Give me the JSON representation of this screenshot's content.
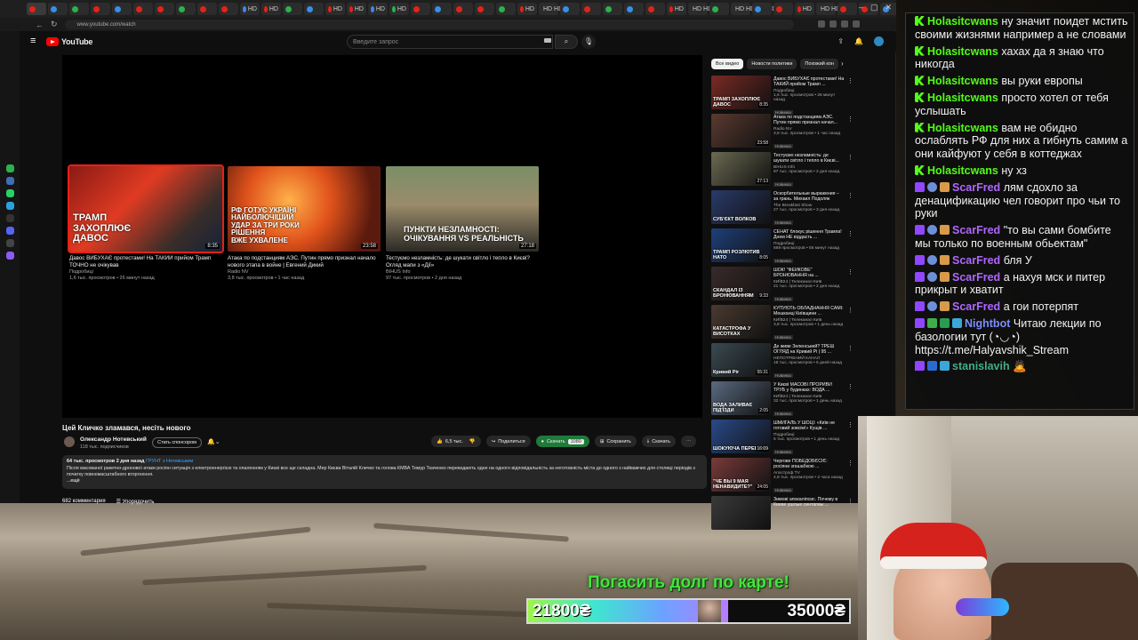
{
  "browser": {
    "url": "www.youtube.com/watch",
    "tabs": [
      "",
      "",
      "",
      "",
      "",
      "",
      "",
      "",
      "",
      "",
      "HD",
      "HD",
      "",
      "",
      "HD",
      "HD",
      "HD",
      "HD",
      "",
      "",
      "",
      "",
      "",
      "HD",
      "HD HD HD",
      "",
      "",
      "",
      "",
      "",
      "HD",
      "HD HD HD",
      "",
      "HD HD HD HD",
      "",
      "",
      "HD",
      "HD HD HD",
      "",
      "",
      "",
      "",
      "",
      "HD",
      "HD"
    ]
  },
  "youtube": {
    "search_placeholder": "Введите запрос",
    "endcards": [
      {
        "title": "Давос ВИБУХАЄ протестами! На ТАКИЙ прийом Трамп ТОЧНО не очікував",
        "channel": "Подробиці",
        "meta": "1,6 тыс. просмотров • 26 минут назад",
        "duration": "8:35",
        "overlay": "ТРАМП\nЗАХОПЛЮЄ\nДАВОС"
      },
      {
        "title": "Атака по подстанциям АЭС. Путин прямо признал начало нового этапа в войне | Евгений Дикий",
        "channel": "Radio NV",
        "meta": "3,8 тыс. просмотров • 1 час назад",
        "duration": "23:58",
        "overlay": "РФ ГОТУЄ УКРАЇНІ\nНАЙБОЛЮЧІШИЙ\nУДАР ЗА ТРИ РОКИ\nРІШЕННЯ\nВЖЕ УХВАЛЕНЕ"
      },
      {
        "title": "Тестуємо незламність: де шукати світло і тепло в Києві? Огляд мапи з «Дії»",
        "channel": "BIHUS Info",
        "meta": "97 тыс. просмотров • 2 дня назад",
        "duration": "27:18",
        "overlay": "ПУНКТИ НЕЗЛАМНОСТІ:\nОЧІКУВАННЯ VS РЕАЛЬНІСТЬ"
      }
    ],
    "video": {
      "title": "Цей Кличко зламався, несіть нового",
      "channel": "Олександр Нотевський",
      "subscribers": "118 тыс. подписчиков",
      "sponsor_label": "Стать спонсором",
      "likes": "6,5 тыс.",
      "share_label": "Поделиться",
      "download_btn_label": "Скачать",
      "save_label": "Сохранить",
      "download_label": "Скачать",
      "desc_meta": "64 тыс. просмотров  2 дня назад",
      "desc_tags": "ГРУНТ з Нотевським",
      "description": "Після масованої ракетно-дронової атаки росіян ситуація з електроенергією та опаленням у Києві все ще складна. Мер Києва Віталій Кличко та голова КМВА Тимур Ткаченко перекидають одне на одного відповідальність за неготовність міста до одного з найважчих для столиці періодів з початку повномасштабного вторгнення.",
      "desc_more": "...ещё",
      "comments_count": "682 комментария",
      "sort_label": "Упорядочить"
    },
    "chips": [
      "Все видео",
      "Новости политики",
      "Похожий кон"
    ],
    "related": [
      {
        "title": "Давос ВИБУХАЄ протестами! На ТАКИЙ прийом Трамп ...",
        "channel": "Подробиці",
        "meta": "1,6 тыс. просмотров • 26 минут назад",
        "badge": "Новинка",
        "duration": "8:35",
        "overlay": "ТРАМП ЗАХОПЛЮЄ ДАВОС"
      },
      {
        "title": "Атака по подстанциям АЭС. Путин прямо признал начал...",
        "channel": "Radio NV",
        "meta": "3,8 тыс. просмотров • 1 час назад",
        "badge": "Новинка",
        "duration": "23:58",
        "overlay": ""
      },
      {
        "title": "Тестуємо незламність: де шукати світло і тепло в Києві...",
        "channel": "BIHUS Info",
        "meta": "97 тыс. просмотров • 2 дня назад",
        "badge": "Новинка",
        "duration": "27:13",
        "overlay": ""
      },
      {
        "title": "Оскорбительные выражения – за грань. Михаил Подоляк",
        "channel": "The Breakfast Show",
        "meta": "27 тыс. просмотров • 3 дня назад",
        "badge": "Новинка",
        "duration": "",
        "overlay": "СУБ'ЄКТ ВОЛКОВ"
      },
      {
        "title": "СЕНАТ блокує рішення Трампа! Днем НЕ віддасть ...",
        "channel": "Подробиці",
        "meta": "669 просмотров • 56 минут назад",
        "badge": "Новинка",
        "duration": "8:05",
        "overlay": "ТРАМП РОЗЛЮТИВ НАТО"
      },
      {
        "title": "ШОК! \"ФЕЙКОВЕ\" БРОНЮВАННЯ на ...",
        "channel": "КИЇВ24 | Телеканал Київ",
        "meta": "21 тыс. просмотров • 2 дня назад",
        "badge": "Новинка",
        "duration": "9:33",
        "overlay": "СКАНДАЛ ІЗ БРОНЮВАННЯМ"
      },
      {
        "title": "КУПУЮТЬ ОБЛАДНАННЯ САМІ: Мешканці Київщини ...",
        "channel": "КИЇВ24 | Телеканал Київ",
        "meta": "3,8 тыс. просмотров • 1 день назад",
        "badge": "Новинка",
        "duration": "",
        "overlay": "КАТАСТРОФА У ВИСОТКАХ"
      },
      {
        "title": "Де живе Зеленський? ТРЕШ ОГЛЯД на Кривий Рі | 95 ...",
        "channel": "НЕПОТРІБНИЙ КАНАЛ",
        "meta": "18 тыс. просмотров • 5 дней назад",
        "badge": "Новинка",
        "duration": "55:31",
        "overlay": "Кривий Ріг"
      },
      {
        "title": "У Києві МАСОВІ ПРОРИВИ ТРУБ у будинках: ВОДА ...",
        "channel": "КИЇВ24 | Телеканал Київ",
        "meta": "32 тыс. просмотров • 1 день назад",
        "badge": "Новинка",
        "duration": "2:05",
        "overlay": "ВОДА ЗАЛИВАЄ ПІД'ЇЗДИ"
      },
      {
        "title": "ШМИГАЛЬ У ШОЦІ: «Київ не готовий зовсім!» Кущів ...",
        "channel": "Подробиці",
        "meta": "5 тыс. просмотров • 1 день назад",
        "badge": "Новинка",
        "duration": "16:09",
        "overlay": "ШОКУЮЧА ПЕРЕВІРКА"
      },
      {
        "title": "Черговe ПОБЕДОБЄСІЄ: росіяни згашабкою ...",
        "channel": "Апостроф TV",
        "meta": "4,8 тыс. просмотров • 2 часа назад",
        "badge": "Новинка",
        "duration": "24:05",
        "overlay": "\"ЧЕ ВЫ 9 МАЯ НЕНАВИДИТЕ?\""
      },
      {
        "title": "Зимові апокаліпсис. Почему в Киеве ушлые синтагмы ...",
        "channel": "",
        "meta": "",
        "badge": "",
        "duration": "",
        "overlay": ""
      }
    ]
  },
  "chat": [
    {
      "badges": [
        "kick"
      ],
      "nick": "Holasitcwans",
      "nick_color": "#53fc18",
      "text": "ну значит поидет мстить своими жизнями например а не словами"
    },
    {
      "badges": [
        "kick"
      ],
      "nick": "Holasitcwans",
      "nick_color": "#53fc18",
      "text": "хахах да я знаю что никогда"
    },
    {
      "badges": [
        "kick"
      ],
      "nick": "Holasitcwans",
      "nick_color": "#53fc18",
      "text": "вы руки европы"
    },
    {
      "badges": [
        "kick"
      ],
      "nick": "Holasitcwans",
      "nick_color": "#53fc18",
      "text": "просто хотел от тебя услышать"
    },
    {
      "badges": [
        "kick"
      ],
      "nick": "Holasitcwans",
      "nick_color": "#53fc18",
      "text": "вам не обидно ослаблять РФ для них а гибнуть самим а они кайфуют у себя в коттеджах"
    },
    {
      "badges": [
        "kick"
      ],
      "nick": "Holasitcwans",
      "nick_color": "#53fc18",
      "text": "ну хз"
    },
    {
      "badges": [
        "tw",
        "globe",
        "star"
      ],
      "nick": "ScarFred",
      "nick_color": "#b066ff",
      "text": "лям сдохло за денацификацию чел говорит про чьи то руки"
    },
    {
      "badges": [
        "tw",
        "globe",
        "star"
      ],
      "nick": "ScarFred",
      "nick_color": "#b066ff",
      "text": "\"то вы сами бомбите мы только по военным обьектам\""
    },
    {
      "badges": [
        "tw",
        "globe",
        "star"
      ],
      "nick": "ScarFred",
      "nick_color": "#b066ff",
      "text": "бля У"
    },
    {
      "badges": [
        "tw",
        "globe",
        "star"
      ],
      "nick": "ScarFred",
      "nick_color": "#b066ff",
      "text": "а нахуя мск и питер прикрыт и хватит"
    },
    {
      "badges": [
        "tw",
        "globe",
        "star"
      ],
      "nick": "ScarFred",
      "nick_color": "#b066ff",
      "text": "а гои потерпят"
    },
    {
      "badges": [
        "tw",
        "green",
        "mod",
        "cyan"
      ],
      "nick": "Nightbot",
      "nick_color": "#7b8cff",
      "text": "Читаю лекции по базологии тут (◔◡◔) https://t.me/Halyavshik_Stream"
    },
    {
      "badges": [
        "tw",
        "blue",
        "cyan"
      ],
      "nick": "stanislavih",
      "nick_color": "#3fae8a",
      "text": "🙇"
    }
  ],
  "donation": {
    "title": "Погасить долг по карте!",
    "current": "21800₴",
    "target": "35000₴",
    "progress": 0.623
  },
  "colors": {
    "accent": "#ff0000",
    "kick": "#53fc18",
    "twitch": "#9146ff",
    "goal_text": "#45e33f"
  }
}
